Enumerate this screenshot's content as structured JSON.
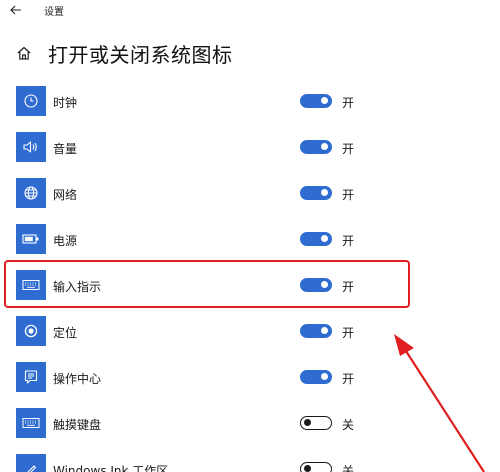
{
  "window": {
    "title": "设置"
  },
  "header": {
    "title": "打开或关闭系统图标"
  },
  "colors": {
    "accent": "#2f6cd1",
    "highlight": "#e02020"
  },
  "items": [
    {
      "label": "时钟",
      "state": "开",
      "on": true,
      "icon": "clock-icon"
    },
    {
      "label": "音量",
      "state": "开",
      "on": true,
      "icon": "volume-icon"
    },
    {
      "label": "网络",
      "state": "开",
      "on": true,
      "icon": "globe-icon"
    },
    {
      "label": "电源",
      "state": "开",
      "on": true,
      "icon": "battery-icon"
    },
    {
      "label": "输入指示",
      "state": "开",
      "on": true,
      "icon": "keyboard-icon"
    },
    {
      "label": "定位",
      "state": "开",
      "on": true,
      "icon": "location-icon"
    },
    {
      "label": "操作中心",
      "state": "开",
      "on": true,
      "icon": "action-center-icon"
    },
    {
      "label": "触摸键盘",
      "state": "关",
      "on": false,
      "icon": "touch-keyboard-icon"
    },
    {
      "label": "Windows Ink 工作区",
      "state": "关",
      "on": false,
      "icon": "pen-icon"
    }
  ]
}
